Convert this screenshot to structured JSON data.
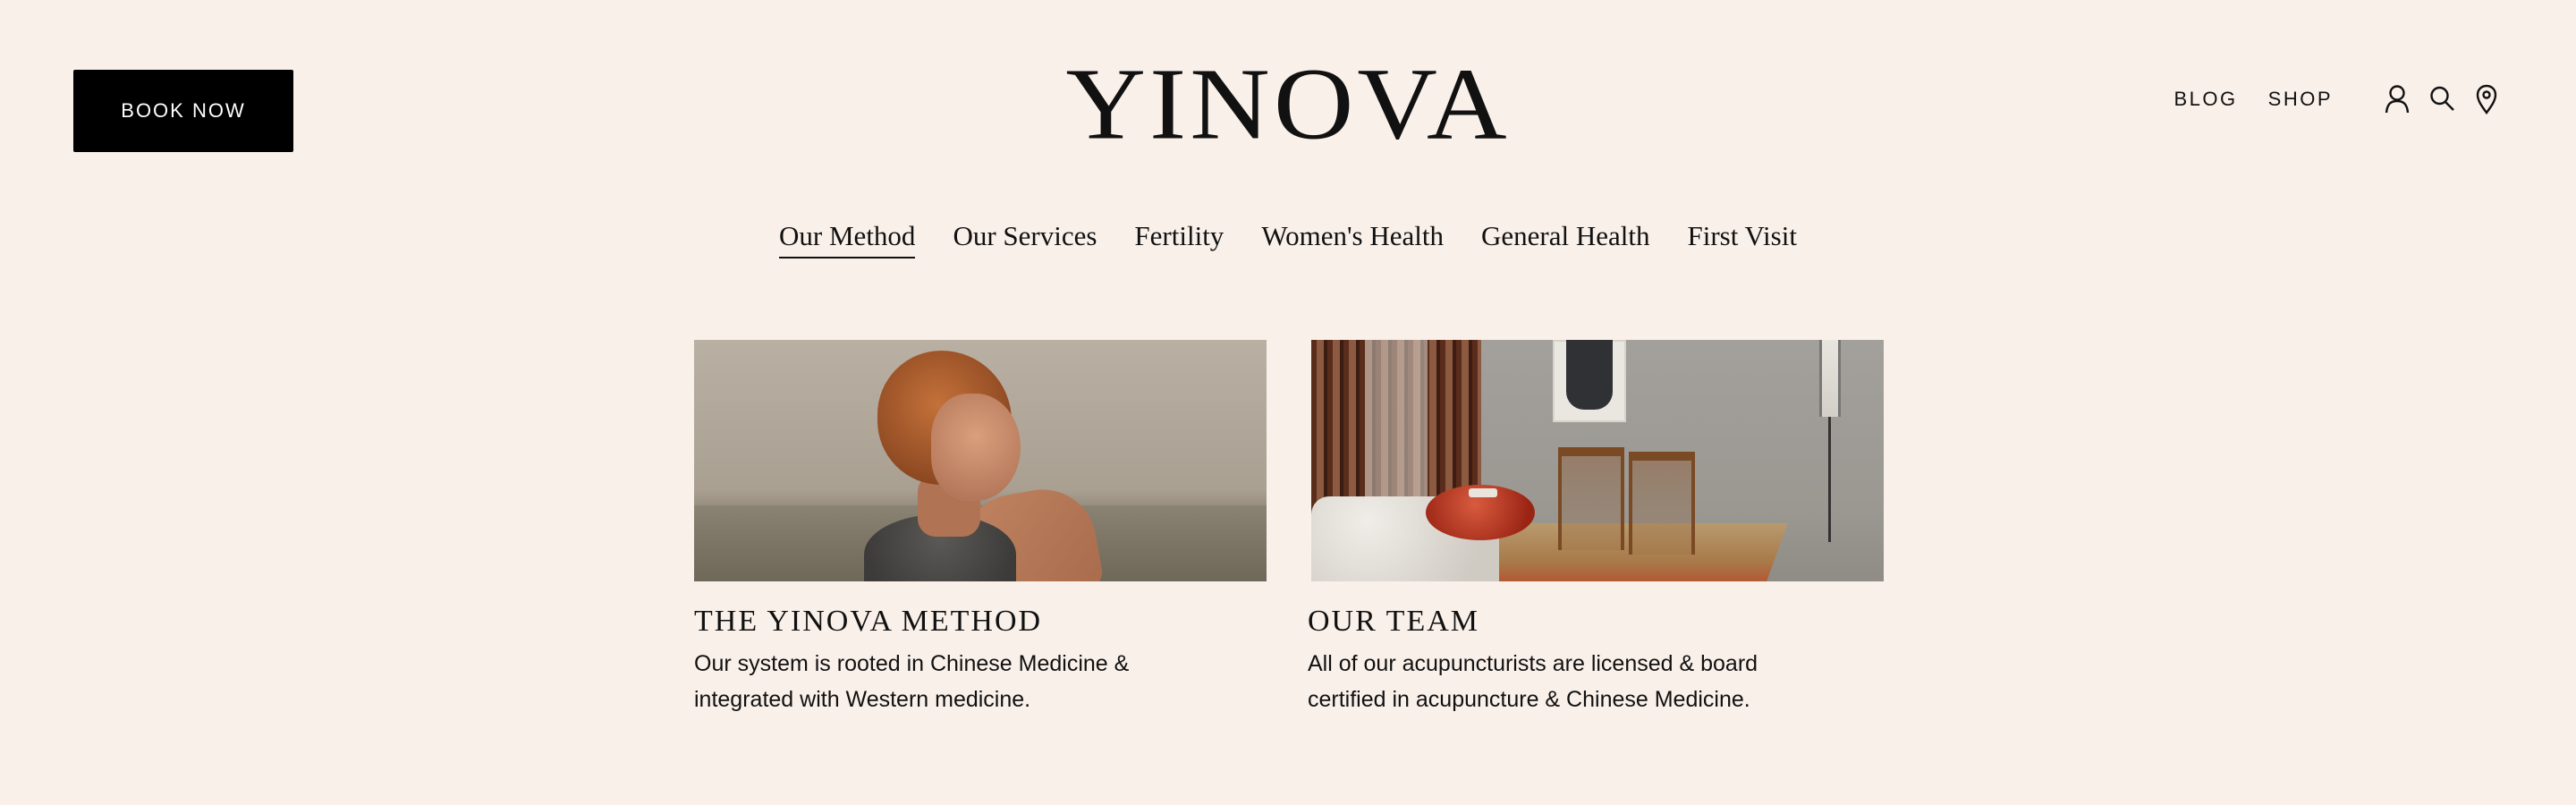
{
  "header": {
    "book_now_label": "BOOK NOW",
    "logo_text": "YINOVA",
    "utility_links": [
      "BLOG",
      "SHOP"
    ],
    "icons": [
      "account-icon",
      "search-icon",
      "location-pin-icon"
    ]
  },
  "main_nav": {
    "items": [
      "Our Method",
      "Our Services",
      "Fertility",
      "Women's Health",
      "General Health",
      "First Visit"
    ],
    "active": "Our Method"
  },
  "cards": [
    {
      "title": "THE YINOVA METHOD",
      "description": "Our system is rooted in Chinese Medicine & integrated with Western medicine.",
      "image": "woman-with-acupuncture-needles"
    },
    {
      "title": "OUR TEAM",
      "description": "All of our acupuncturists are licensed & board certified in acupuncture & Chinese Medicine.",
      "image": "clinic-interior-room"
    }
  ],
  "colors": {
    "background": "#f9f0ea",
    "button": "#000000",
    "text": "#111111"
  }
}
